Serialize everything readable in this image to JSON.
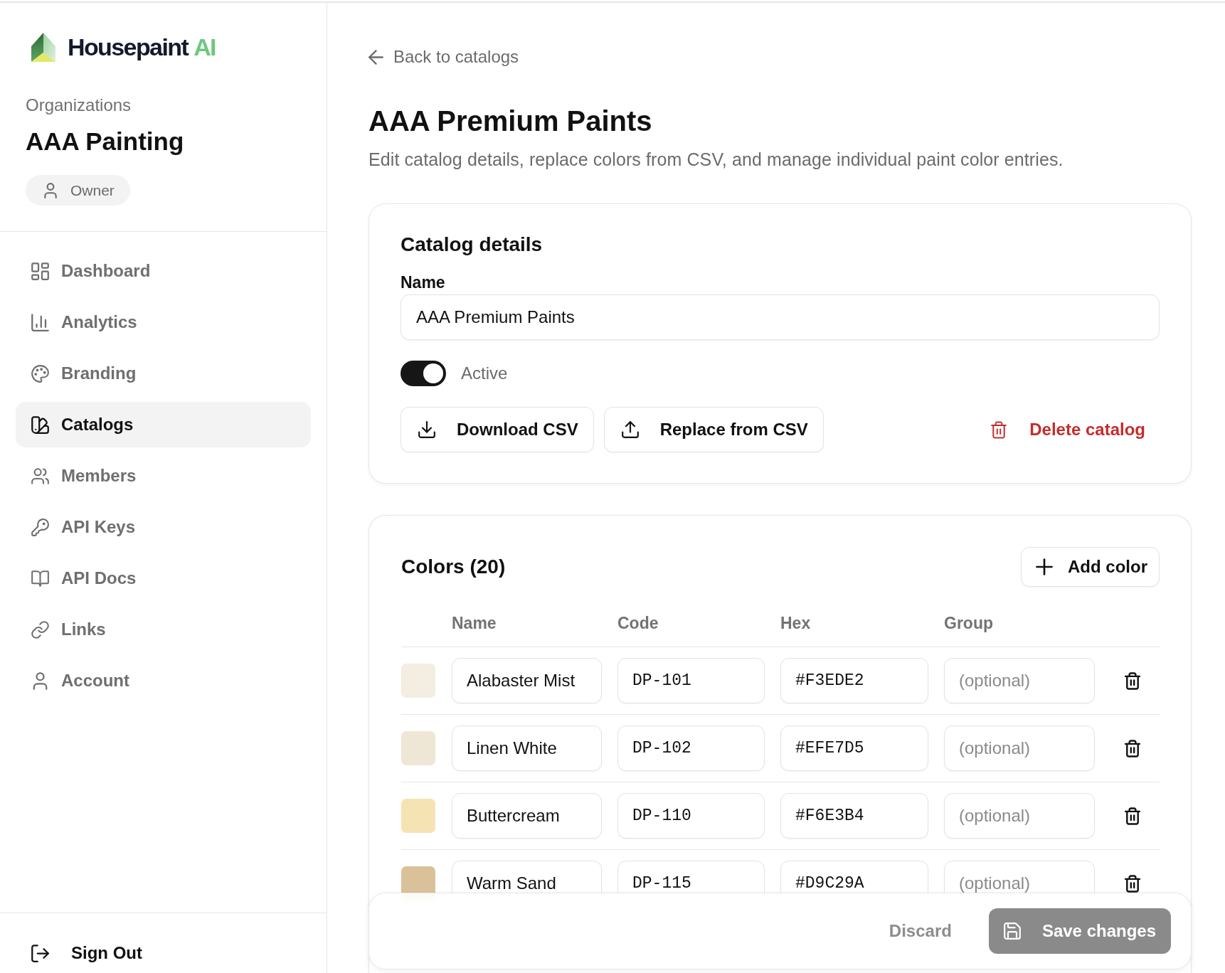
{
  "brand": {
    "name": "Housepaint",
    "suffix": "AI"
  },
  "organization": {
    "label": "Organizations",
    "name": "AAA Painting",
    "role": "Owner"
  },
  "nav": [
    {
      "label": "Dashboard",
      "kind": "dashboard",
      "selected": false
    },
    {
      "label": "Analytics",
      "kind": "analytics",
      "selected": false
    },
    {
      "label": "Branding",
      "kind": "branding",
      "selected": false
    },
    {
      "label": "Catalogs",
      "kind": "catalogs",
      "selected": true
    },
    {
      "label": "Members",
      "kind": "members",
      "selected": false
    },
    {
      "label": "API Keys",
      "kind": "keys",
      "selected": false
    },
    {
      "label": "API Docs",
      "kind": "docs",
      "selected": false
    },
    {
      "label": "Links",
      "kind": "links",
      "selected": false
    },
    {
      "label": "Account",
      "kind": "account",
      "selected": false
    }
  ],
  "sign_out": "Sign Out",
  "back_link": "Back to catalogs",
  "page": {
    "title": "AAA Premium Paints",
    "subtitle": "Edit catalog details, replace colors from CSV, and manage individual paint color entries."
  },
  "catalog_details": {
    "heading": "Catalog details",
    "name_label": "Name",
    "name_value": "AAA Premium Paints",
    "active": {
      "label": "Active",
      "on": true
    },
    "actions": [
      {
        "label": "Download CSV",
        "kind": "download"
      },
      {
        "label": "Replace from CSV",
        "kind": "upload"
      }
    ],
    "delete_label": "Delete catalog"
  },
  "colors": {
    "heading": "Colors (20)",
    "add_label": "Add color",
    "columns": [
      "Name",
      "Code",
      "Hex",
      "Group"
    ],
    "rows": [
      {
        "color": "#f3ede2",
        "name": "Alabaster Mist",
        "code": "DP-101",
        "hex": "#F3EDE2",
        "group_placeholder": "(optional)"
      },
      {
        "color": "#efe7d5",
        "name": "Linen White",
        "code": "DP-102",
        "hex": "#EFE7D5",
        "group_placeholder": "(optional)"
      },
      {
        "color": "#f6e3b4",
        "name": "Buttercream",
        "code": "DP-110",
        "hex": "#F6E3B4",
        "group_placeholder": "(optional)"
      },
      {
        "color": "#d9c29a",
        "name": "Warm Sand",
        "code": "DP-115",
        "hex": "#D9C29A",
        "group_placeholder": "(optional)"
      }
    ]
  },
  "save_bar": {
    "discard": {
      "label": "Discard",
      "disabled": true
    },
    "save": {
      "label": "Save changes",
      "disabled": true
    }
  }
}
